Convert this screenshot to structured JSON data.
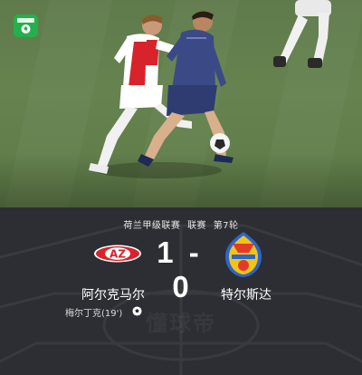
{
  "header": {
    "app_badge_text": "懂球帝",
    "app_badge_icon": "soccer-ball-icon"
  },
  "match": {
    "league": "荷兰甲级联赛",
    "stage": "联赛",
    "round": "第7轮",
    "home_score": "1",
    "separator": "-",
    "away_score": "0",
    "home_team": "阿尔克马尔",
    "away_team": "特尔斯达",
    "scorer": "梅尔丁克(19')",
    "home_logo_text": "AZ",
    "watermark": "懂球帝"
  },
  "colors": {
    "pitch": "#62804c",
    "panel": "#2c2e33",
    "badge": "#22b14c",
    "home_red": "#d8232a",
    "away_blue": "#2b66c9",
    "away_yellow": "#f2c318"
  }
}
